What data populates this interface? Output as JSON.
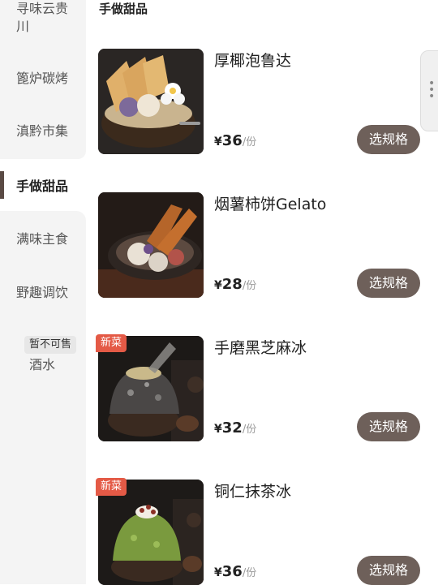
{
  "sidebar": {
    "items": [
      {
        "label": "寻味云贵\n川"
      },
      {
        "label": "篦炉碳烤"
      },
      {
        "label": "滇黔市集"
      },
      {
        "label": "手做甜品"
      },
      {
        "label": "满味主食"
      },
      {
        "label": "野趣调饮"
      },
      {
        "label": "酒水",
        "badge": "暂不可售"
      }
    ],
    "active_index": 3
  },
  "main": {
    "section_title": "手做甜品",
    "products": [
      {
        "name": "厚椰泡鲁达",
        "currency": "¥",
        "price": "36",
        "unit": "/份",
        "button": "选规格",
        "badge": ""
      },
      {
        "name": "烟薯柿饼Gelato",
        "currency": "¥",
        "price": "28",
        "unit": "/份",
        "button": "选规格",
        "badge": ""
      },
      {
        "name": "手磨黑芝麻冰",
        "currency": "¥",
        "price": "32",
        "unit": "/份",
        "button": "选规格",
        "badge": "新菜"
      },
      {
        "name": "铜仁抹茶冰",
        "currency": "¥",
        "price": "36",
        "unit": "/份",
        "button": "选规格",
        "badge": "新菜"
      }
    ]
  },
  "colors": {
    "sidebar_bg": "#f4f4f4",
    "button_bg": "#6e605a",
    "new_badge": "#e45a46",
    "active_bar": "#5a4a44"
  }
}
